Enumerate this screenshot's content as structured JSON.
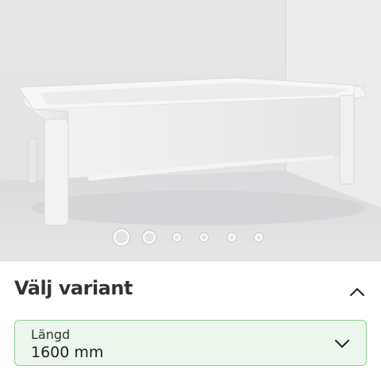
{
  "gallery": {
    "image_alt_icon": "bathtub-product-image",
    "slide_count": 6,
    "active_index": 0
  },
  "variant": {
    "title": "Välj variant",
    "expanded": true,
    "field_label": "Längd",
    "field_value": "1600 mm",
    "accent_color": "#8fcf8f",
    "field_bg": "#ecf6ec"
  }
}
